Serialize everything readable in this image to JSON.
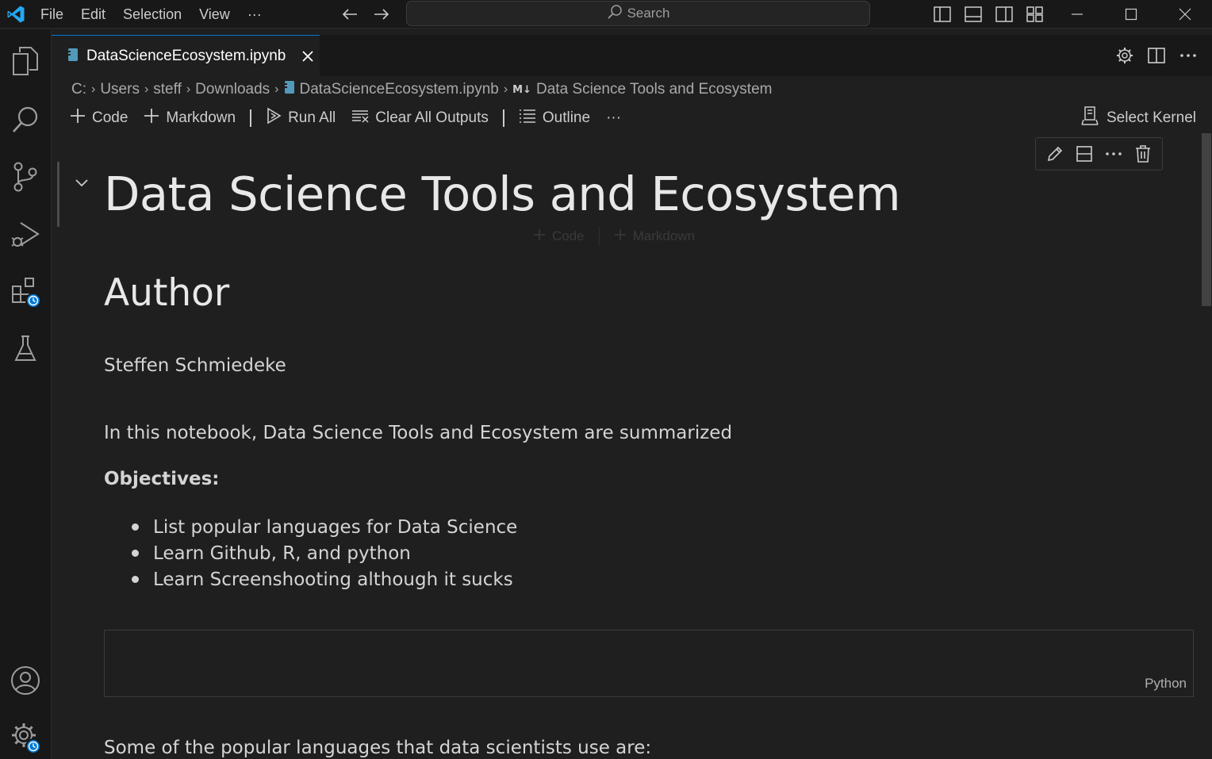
{
  "titlebar": {
    "menu": [
      "File",
      "Edit",
      "Selection",
      "View",
      "···"
    ],
    "search_placeholder": "Search"
  },
  "tab": {
    "label": "DataScienceEcosystem.ipynb"
  },
  "breadcrumb": {
    "drive": "C:",
    "users": "Users",
    "user": "steff",
    "folder": "Downloads",
    "file": "DataScienceEcosystem.ipynb",
    "md_icon": "M↓",
    "section": "Data Science Tools and Ecosystem"
  },
  "toolbar": {
    "code": "Code",
    "markdown": "Markdown",
    "run_all": "Run All",
    "clear_outputs": "Clear All Outputs",
    "outline": "Outline",
    "more": "···",
    "select_kernel": "Select Kernel"
  },
  "ghost_insert": {
    "code": "Code",
    "markdown": "Markdown"
  },
  "notebook": {
    "title": "Data Science Tools and Ecosystem",
    "author_heading": "Author",
    "author_name": "Steffen Schmiedeke",
    "intro": "In this notebook, Data Science Tools and Ecosystem are summarized",
    "objectives_label": "Objectives:",
    "objectives": [
      "List popular languages for Data Science",
      "Learn Github, R, and python",
      "Learn Screenshooting although it sucks"
    ],
    "code_cell_language": "Python",
    "next_text": "Some of the popular languages that data scientists use are:"
  },
  "colors": {
    "accent": "#0078d4",
    "background": "#1f1f1f",
    "sidebar": "#181818"
  }
}
